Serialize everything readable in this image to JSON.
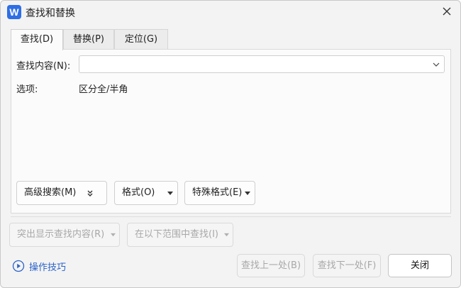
{
  "window": {
    "app_icon_letter": "W",
    "title": "查找和替换"
  },
  "tabs": [
    {
      "label": "查找(D)",
      "active": true
    },
    {
      "label": "替换(P)",
      "active": false
    },
    {
      "label": "定位(G)",
      "active": false
    }
  ],
  "find": {
    "label": "查找内容(N):",
    "value": ""
  },
  "options": {
    "label": "选项:",
    "value": "区分全/半角"
  },
  "panel_buttons": {
    "advanced": "高级搜索(M)",
    "format": "格式(O)",
    "special": "特殊格式(E)"
  },
  "lower_buttons": {
    "highlight": "突出显示查找内容(R)",
    "find_in": "在以下范围中查找(I)"
  },
  "footer": {
    "tips": "操作技巧",
    "find_prev": "查找上一处(B)",
    "find_next": "查找下一处(F)",
    "close": "关闭"
  },
  "colors": {
    "accent": "#2f6fe4",
    "link": "#2a62c9"
  }
}
